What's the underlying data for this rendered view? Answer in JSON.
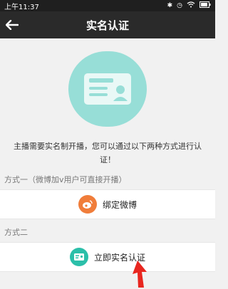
{
  "status_bar": {
    "time": "上午11:37"
  },
  "header": {
    "title": "实名认证"
  },
  "description": "主播需要实名制开播，您可以通过以下两种方式进行认证！",
  "options": [
    {
      "section_label": "方式一（微博加v用户可直接开播）",
      "button_label": "绑定微博",
      "icon": "weibo-icon",
      "color": "#f07d3a"
    },
    {
      "section_label": "方式二",
      "button_label": "立即实名认证",
      "icon": "id-card-icon",
      "color": "#2bbfa9"
    }
  ],
  "colors": {
    "accent": "#97ded7",
    "header_bg": "#2a2a2a"
  }
}
